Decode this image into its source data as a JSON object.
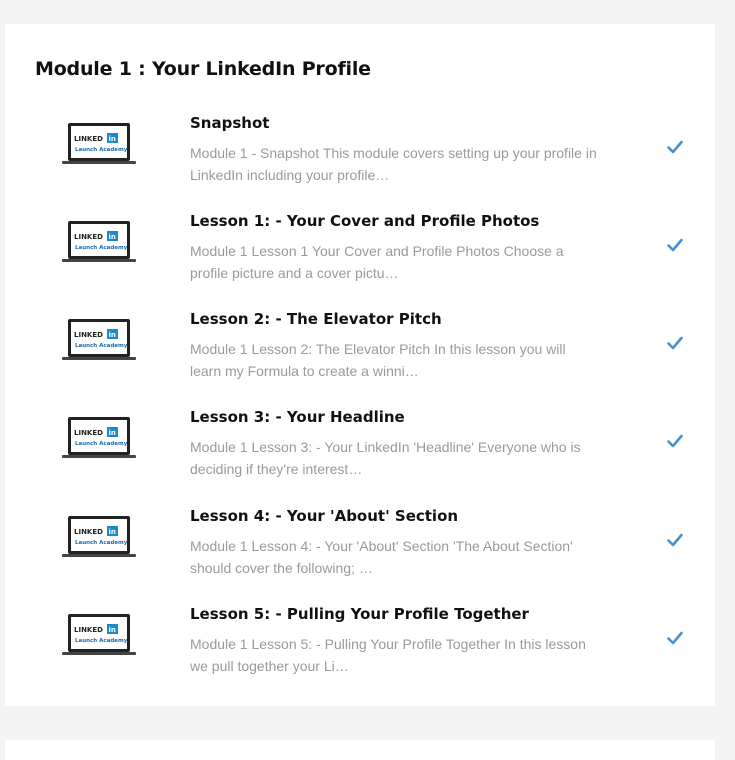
{
  "module": {
    "title": "Module 1 : Your LinkedIn Profile"
  },
  "thumbnail": {
    "logo_top": "LINKED",
    "logo_badge": "in",
    "logo_bottom": "Launch Academy"
  },
  "colors": {
    "check": "#4a8fd0",
    "badge": "#1a8bc9",
    "title": "#111111",
    "description": "#9a9a9a"
  },
  "lessons": [
    {
      "title": "Snapshot",
      "description": "Module 1 - Snapshot This module covers setting up your profile in LinkedIn including your profile…",
      "status_icon": "check-icon"
    },
    {
      "title": "Lesson 1: - Your Cover and Profile Photos",
      "description": "Module 1 Lesson 1   Your Cover and Profile Photos Choose a profile picture and a cover pictu…",
      "status_icon": "check-icon"
    },
    {
      "title": "Lesson 2: - The Elevator Pitch",
      "description": "Module 1 Lesson 2: The Elevator Pitch In this lesson you will learn my Formula to create a winni…",
      "status_icon": "check-icon"
    },
    {
      "title": "Lesson 3: - Your Headline",
      "description": "Module 1 Lesson 3: - Your LinkedIn 'Headline'   Everyone who is deciding if they're interest…",
      "status_icon": "check-icon"
    },
    {
      "title": "Lesson 4: - Your 'About' Section",
      "description": "Module 1 Lesson 4: - Your 'About' Section   'The About Section' should cover the following; …",
      "status_icon": "check-icon"
    },
    {
      "title": "Lesson 5: - Pulling Your Profile Together",
      "description": "Module 1 Lesson 5: - Pulling Your Profile Together   In this lesson we pull together your Li…",
      "status_icon": "check-icon"
    }
  ]
}
